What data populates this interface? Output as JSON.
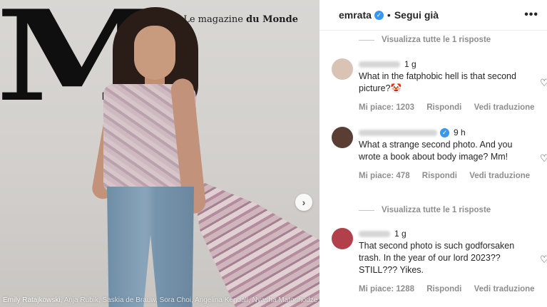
{
  "post": {
    "magazine_name_pre": "Le magazine",
    "magazine_name_bold": "du Monde",
    "masthead_letter": "M",
    "caption_first": "Emily Ratajkowski,",
    "caption_rest": " Anja Rubik, Saskia de Brauw, Sora Choi, Angelina Kendall, Nyasha Matonhodze..."
  },
  "header": {
    "username": "emrata",
    "verified_glyph": "✓",
    "separator": "•",
    "follow_label": "Segui già",
    "more_label": "•••"
  },
  "replies_link_1": "Visualizza tutte le 1 risposte",
  "replies_link_2": "Visualizza tutte le 1 risposte",
  "comments": [
    {
      "time": "1 g",
      "text": "What in the fatphobic hell is that second picture?🤡",
      "likes": "Mi piace: 1203",
      "reply": "Rispondi",
      "translate": "Vedi traduzione",
      "avatar_color": "#d9c3b4"
    },
    {
      "time": "9 h",
      "text": "What a strange second photo. And you wrote a book about body image? Mm!",
      "likes": "Mi piace: 478",
      "reply": "Rispondi",
      "translate": "Vedi traduzione",
      "avatar_color": "#5a3e33"
    },
    {
      "time": "1 g",
      "text": "That second photo is such godforsaken trash. In the year of our lord 2023?? STILL??? Yikes.",
      "likes": "Mi piace: 1288",
      "reply": "Rispondi",
      "translate": "Vedi traduzione",
      "avatar_color": "#b2404a"
    }
  ],
  "icons": {
    "heart": "♡",
    "next": "›"
  }
}
